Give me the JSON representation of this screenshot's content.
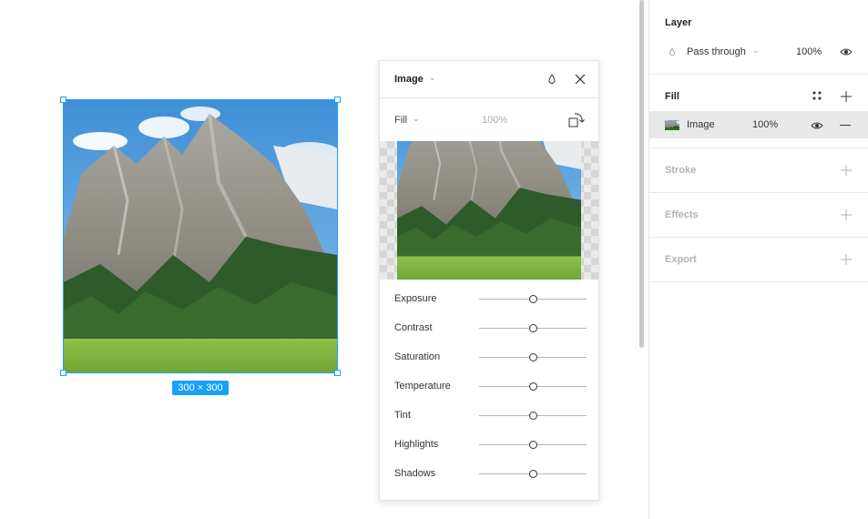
{
  "canvas": {
    "size_badge": "300 × 300"
  },
  "image_panel": {
    "title": "Image",
    "fill_mode": "Fill",
    "opacity": "100%",
    "adjustments": [
      {
        "label": "Exposure",
        "value": 0
      },
      {
        "label": "Contrast",
        "value": 0
      },
      {
        "label": "Saturation",
        "value": 0
      },
      {
        "label": "Temperature",
        "value": 0
      },
      {
        "label": "Tint",
        "value": 0
      },
      {
        "label": "Highlights",
        "value": 0
      },
      {
        "label": "Shadows",
        "value": 0
      }
    ]
  },
  "properties": {
    "layer": {
      "title": "Layer",
      "blend_mode": "Pass through",
      "opacity": "100%"
    },
    "fill": {
      "title": "Fill",
      "item_name": "Image",
      "item_opacity": "100%"
    },
    "stroke": {
      "title": "Stroke"
    },
    "effects": {
      "title": "Effects"
    },
    "export": {
      "title": "Export"
    }
  },
  "icons": {
    "eye": "eye-icon",
    "plus": "plus-icon",
    "minus": "minus-icon",
    "close": "close-icon",
    "drop": "drop-icon",
    "rotate": "rotate-icon",
    "styles": "four-dots-icon",
    "chevron": "chevron-down-icon"
  },
  "colors": {
    "selection": "#18a0fb",
    "fill_row_bg": "#e9e9e9"
  }
}
